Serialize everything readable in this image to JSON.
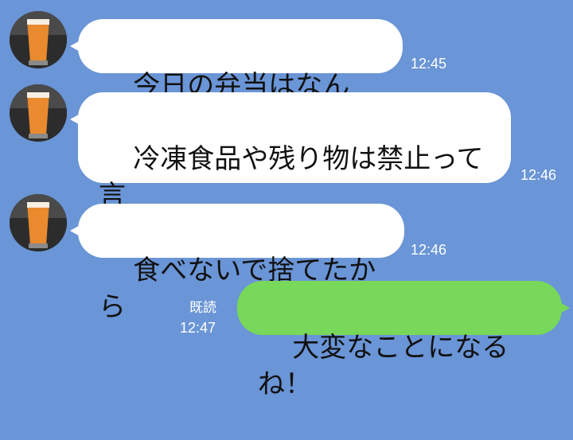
{
  "messages": [
    {
      "sender": "other",
      "text": "今日の弁当はなんだ？",
      "time": "12:45"
    },
    {
      "sender": "other",
      "text": "冷凍食品や残り物は禁止って言\nっただろ！",
      "time": "12:46"
    },
    {
      "sender": "other",
      "text": "食べないで捨てたから",
      "time": "12:46"
    },
    {
      "sender": "me",
      "text": "大変なことになるね！",
      "time": "12:47",
      "read_label": "既読"
    }
  ],
  "colors": {
    "background": "#6a95d6",
    "incoming_bubble": "#ffffff",
    "outgoing_bubble": "#78d85a",
    "avatar_icon": "beer-glass-icon"
  }
}
